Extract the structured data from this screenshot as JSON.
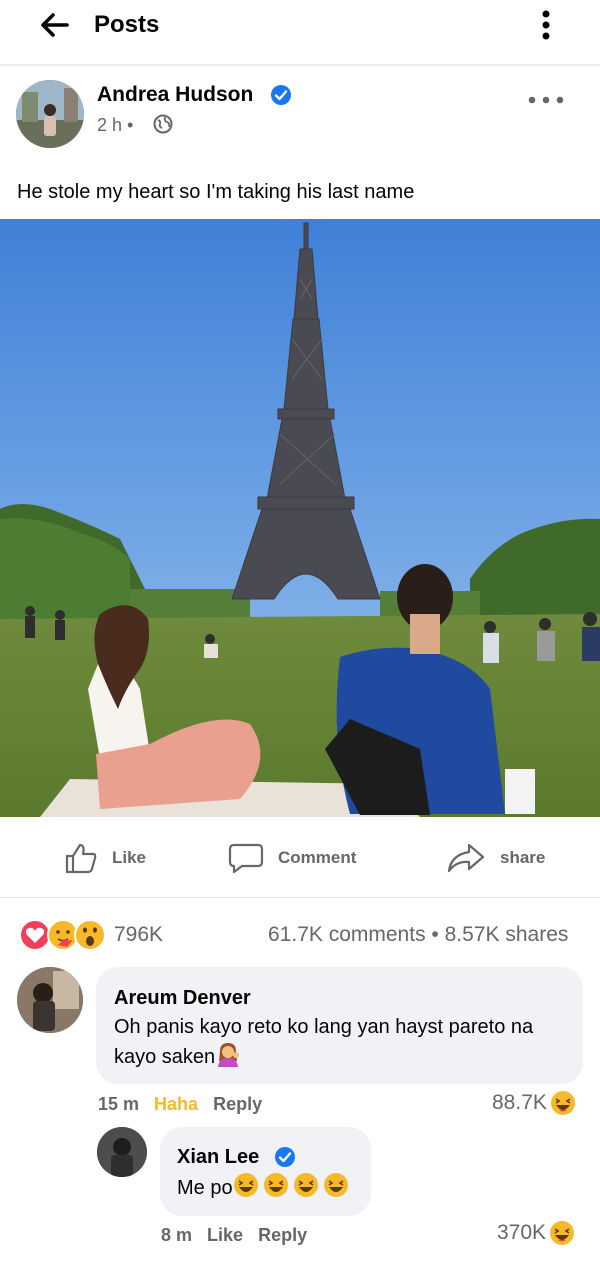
{
  "topbar": {
    "title": "Posts",
    "back_icon": "arrow-left-icon",
    "menu_icon": "vertical-dots-icon"
  },
  "post": {
    "author": "Andrea Hudson",
    "time": "2 h",
    "separator": "•",
    "privacy_icon": "globe-icon",
    "text": "He stole my heart so I'm taking his last name",
    "photo": "couple sitting on grass facing the Eiffel Tower"
  },
  "actions": {
    "like": "Like",
    "comment": "Comment",
    "share": "share"
  },
  "stats": {
    "reaction_icons": [
      "love-reaction-icon",
      "care-reaction-icon",
      "wow-reaction-icon"
    ],
    "reactions": "796K",
    "comments": "61.7K comments",
    "shares": "8.57K shares",
    "dot": "•"
  },
  "comments": [
    {
      "name": "Areum Denver",
      "text_line1": "Oh panis kayo reto ko lang yan hayst pareto na",
      "text_line2": "kayo saken",
      "emoji": "person-tipping-hand-emoji",
      "time": "15 m",
      "reaction_label": "Haha",
      "reply": "Reply",
      "reaction_count": "88.7K"
    },
    {
      "name": "Xian Lee",
      "text": "Me po",
      "emoji": "laughing-emoji",
      "time": "8 m",
      "like": "Like",
      "reply": "Reply",
      "reaction_count": "370K"
    }
  ],
  "colors": {
    "accent_blue": "#1877f2",
    "muted_text": "#65676b",
    "haha_yellow": "#f7b928",
    "bubble_bg": "#f0f2f5",
    "sky": "#4f8ede"
  }
}
